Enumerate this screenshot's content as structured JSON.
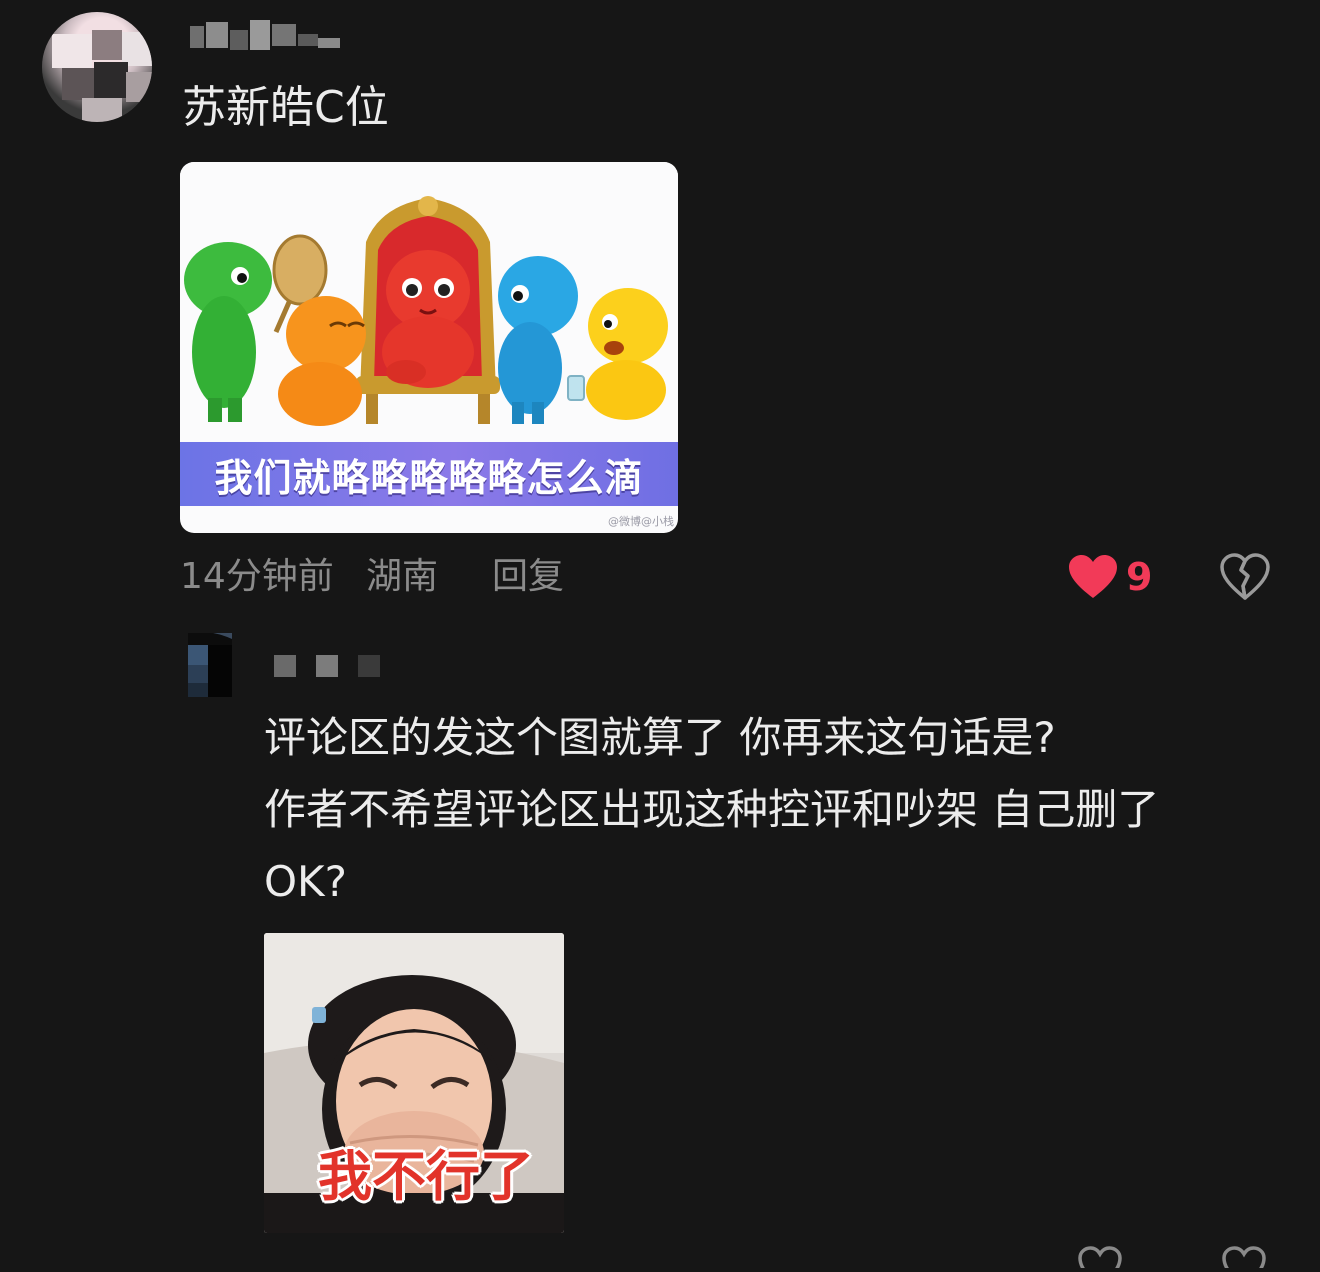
{
  "comment": {
    "text": "苏新皓C位",
    "image": {
      "caption": "我们就略略略略略怎么滴",
      "watermark": "@微博@小栈"
    },
    "meta": {
      "time": "14分钟前",
      "location": "湖南",
      "reply_label": "回复"
    },
    "likes": {
      "count": "9"
    }
  },
  "reply": {
    "lines": [
      "评论区的发这个图就算了 你再来这句话是?",
      "作者不希望评论区出现这种控评和吵架 自己删了",
      "OK?"
    ],
    "image": {
      "caption": "我不行了"
    }
  },
  "colors": {
    "background": "#161616",
    "text": "#ececec",
    "meta": "#8b8b8b",
    "like": "#f23a58",
    "caption_bar": "#7a76e6",
    "sticker_caption": "#e2332a"
  },
  "icons": [
    "heart-icon",
    "broken-heart-icon"
  ]
}
